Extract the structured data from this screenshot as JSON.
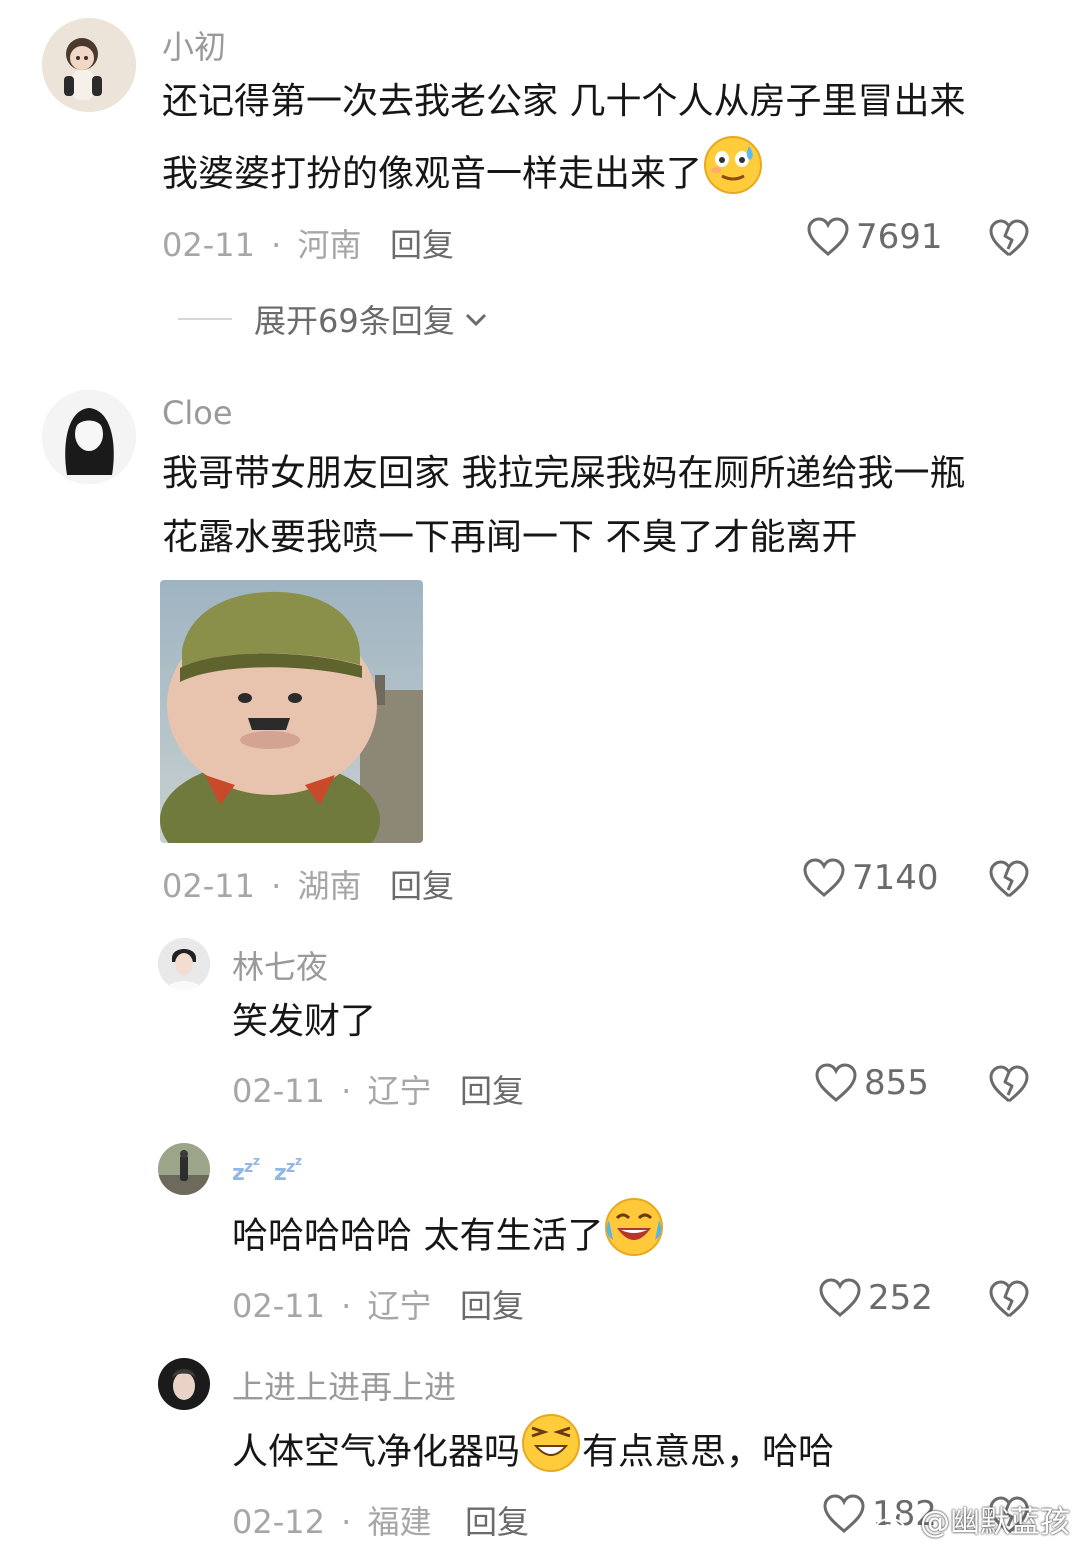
{
  "comments": [
    {
      "user": "小初",
      "text1": "还记得第一次去我老公家 几十个人从房子里冒出来",
      "text2": "我婆婆打扮的像观音一样走出来了",
      "emoji": "crying-smile-emoji",
      "date": "02-11",
      "sep": "·",
      "location": "河南",
      "reply": "回复",
      "likes": "7691",
      "expand": "展开69条回复"
    },
    {
      "user": "Cloe",
      "text1": "我哥带女朋友回家 我拉完屎我妈在厕所递给我一瓶",
      "text2": "花露水要我喷一下再闻一下 不臭了才能离开",
      "image": "cartoon-soldier-meme-image",
      "date": "02-11",
      "sep": "·",
      "location": "湖南",
      "reply": "回复",
      "likes": "7140"
    }
  ],
  "replies": [
    {
      "user": "林七夜",
      "text": "笑发财了",
      "date": "02-11",
      "sep": "·",
      "location": "辽宁",
      "reply": "回复",
      "likes": "855"
    },
    {
      "user": "zzz-zzz-username-icon",
      "text": "哈哈哈哈哈 太有生活了",
      "emoji": "laughing-crying-emoji",
      "date": "02-11",
      "sep": "·",
      "location": "辽宁",
      "reply": "回复",
      "likes": "252"
    },
    {
      "user": "上进上进再上进",
      "text_before": "人体空气净化器吗",
      "text_after": "有点意思，哈哈",
      "emoji": "squint-laugh-emoji",
      "date": "02-12",
      "sep": "·",
      "location": "福建",
      "reply": "回复",
      "likes": "182"
    }
  ],
  "watermark": "@幽默蓝孩",
  "colors": {
    "text": "#161616",
    "meta": "#a6a6a6",
    "action": "#6b6b6b",
    "background": "#ffffff"
  }
}
